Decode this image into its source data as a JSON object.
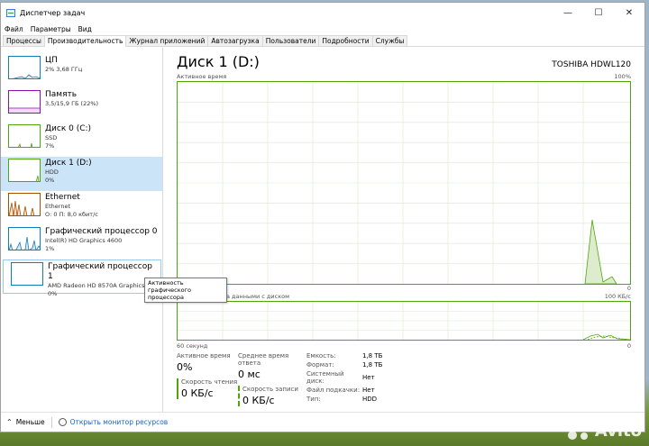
{
  "window": {
    "title": "Диспетчер задач",
    "controls": [
      "—",
      "☐",
      "✕"
    ]
  },
  "menu": [
    "Файл",
    "Параметры",
    "Вид"
  ],
  "tabs": [
    "Процессы",
    "Производительность",
    "Журнал приложений",
    "Автозагрузка",
    "Пользователи",
    "Подробности",
    "Службы"
  ],
  "active_tab": 1,
  "sidebar": [
    {
      "name": "ЦП",
      "sub1": "2% 3,68 ГГц",
      "sub2": "",
      "color": "#117dbb"
    },
    {
      "name": "Память",
      "sub1": "3,5/15,9 ГБ (22%)",
      "sub2": "",
      "color": "#8b12ae"
    },
    {
      "name": "Диск 0 (C:)",
      "sub1": "SSD",
      "sub2": "7%",
      "color": "#4da60c"
    },
    {
      "name": "Диск 1 (D:)",
      "sub1": "HDD",
      "sub2": "0%",
      "color": "#4da60c"
    },
    {
      "name": "Ethernet",
      "sub1": "Ethernet",
      "sub2": "О: 0 П: 8,0 кбит/с",
      "color": "#a74f01"
    },
    {
      "name": "Графический процессор 0",
      "sub1": "Intel(R) HD Graphics 4600",
      "sub2": "1%",
      "color": "#117dbb"
    },
    {
      "name": "Графический процессор 1",
      "sub1": "AMD Radeon HD 8570A Graphics",
      "sub2": "0%",
      "color": "#117dbb"
    }
  ],
  "selected_index": 3,
  "main": {
    "title": "Диск 1 (D:)",
    "model": "TOSHIBA HDWL120",
    "graph1_label": "Активное время",
    "graph1_max": "100%",
    "graph1_min": "0",
    "graph2_label": "Скорость обмена данными с диском",
    "graph2_max": "100 КБ/с",
    "graph2_min": "0",
    "time_label": "60 секунд"
  },
  "stats": {
    "active_time_label": "Активное время",
    "active_time_value": "0%",
    "response_label": "Среднее время ответа",
    "response_value": "0 мс",
    "read_label": "Скорость чтения",
    "read_value": "0 КБ/с",
    "write_label": "Скорость записи",
    "write_value": "0 КБ/с"
  },
  "properties": [
    {
      "k": "Емкость:",
      "v": "1,8 ТБ"
    },
    {
      "k": "Формат:",
      "v": "1,8 ТБ"
    },
    {
      "k": "Системный диск:",
      "v": "Нет"
    },
    {
      "k": "Файл подкачки:",
      "v": "Нет"
    },
    {
      "k": "Тип:",
      "v": "HDD"
    }
  ],
  "tooltip": "Активность графического процессора",
  "footer": {
    "less": "Меньше",
    "resmon": "Открыть монитор ресурсов"
  },
  "watermark": "Avito",
  "colors": {
    "disk": "#4da60c",
    "selected": "#cce4f7",
    "link": "#1565c0"
  }
}
